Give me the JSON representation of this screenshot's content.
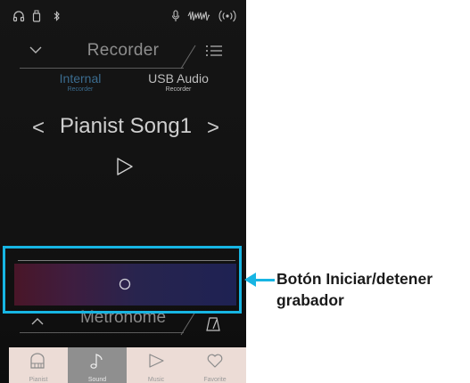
{
  "header": {
    "title": "Recorder"
  },
  "tabs": [
    {
      "label": "Internal",
      "sublabel": "Recorder",
      "active": true
    },
    {
      "label": "USB Audio",
      "sublabel": "Recorder",
      "active": false
    }
  ],
  "song": {
    "title": "Pianist Song1",
    "prev_glyph": "<",
    "next_glyph": ">"
  },
  "metronome": {
    "label": "Metronome"
  },
  "nav": {
    "items": [
      {
        "label": "Pianist",
        "icon": "piano-icon"
      },
      {
        "label": "Sound",
        "icon": "music-note-icon",
        "selected": true
      },
      {
        "label": "Music",
        "icon": "play-icon"
      },
      {
        "label": "Favorite",
        "icon": "heart-icon"
      }
    ]
  },
  "callout": {
    "text": "Botón Iniciar/detener grabador"
  },
  "colors": {
    "highlight": "#17b5e3",
    "active_tab": "#3b6c8f",
    "nav_bg": "#ecdcd6",
    "nav_selected": "#8f8f8f"
  }
}
